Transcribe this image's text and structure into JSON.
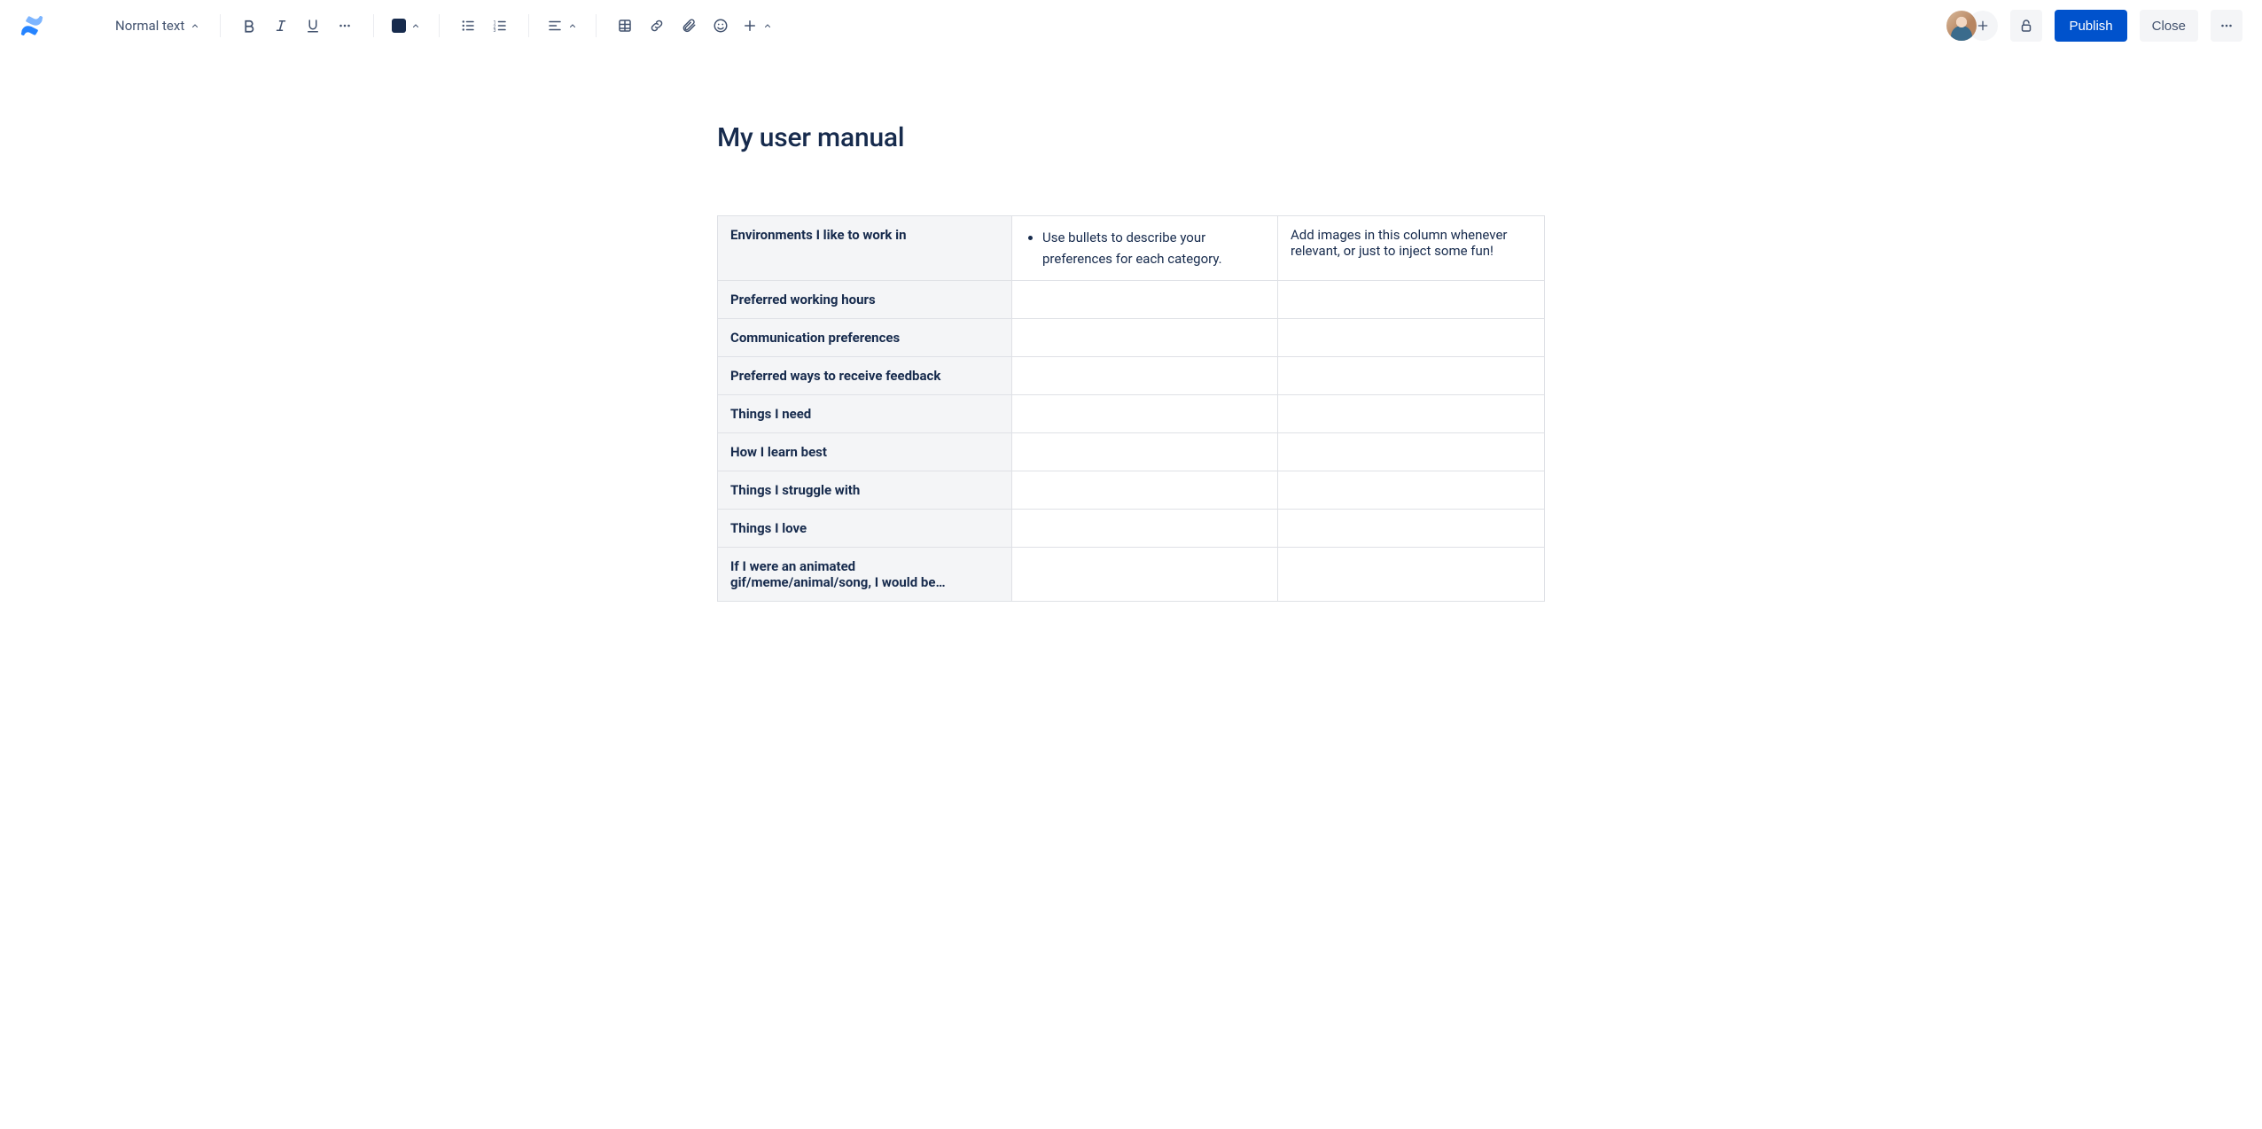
{
  "toolbar": {
    "text_style": "Normal text",
    "publish": "Publish",
    "close": "Close"
  },
  "page": {
    "title": "My user manual"
  },
  "table": {
    "rows": [
      {
        "label": "Environments I like to work in",
        "col2_bullet": "Use bullets to describe your preferences for each category.",
        "col3": "Add images in this column whenever relevant, or just to inject some fun!"
      },
      {
        "label": "Preferred working hours"
      },
      {
        "label": "Communication preferences"
      },
      {
        "label": "Preferred ways to receive feedback"
      },
      {
        "label": "Things I need"
      },
      {
        "label": "How I learn best"
      },
      {
        "label": "Things I struggle with"
      },
      {
        "label": "Things I love"
      },
      {
        "label": "If I were an animated gif/meme/animal/song, I would be…"
      }
    ]
  }
}
